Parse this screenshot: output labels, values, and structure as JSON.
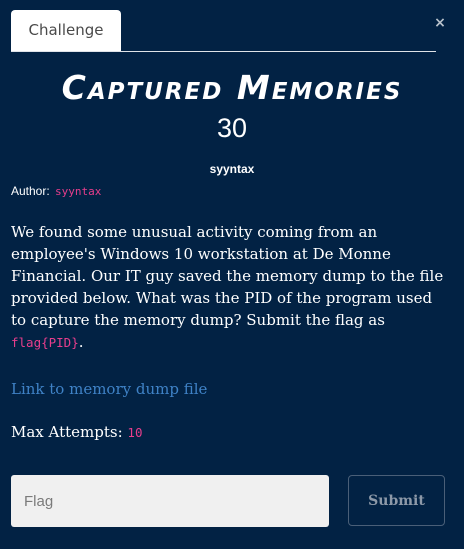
{
  "modal": {
    "close_label": "×",
    "tab_label": "Challenge"
  },
  "challenge": {
    "title": "Captured Memories",
    "points": "30",
    "tag": "syyntax",
    "author_label": "Author:",
    "author_name": "syyntax",
    "description": "We found some unusual activity coming from an employee's Windows 10 workstation at De Monne Financial. Our IT guy saved the memory dump to the file provided below. What was the PID of the program used to capture the memory dump? Submit the flag as",
    "flag_format": "flag{PID}",
    "description_end": ".",
    "link_text": "Link to memory dump file",
    "max_attempts_label": "Max Attempts:",
    "max_attempts_value": "10"
  },
  "form": {
    "flag_placeholder": "Flag",
    "submit_label": "Submit"
  }
}
